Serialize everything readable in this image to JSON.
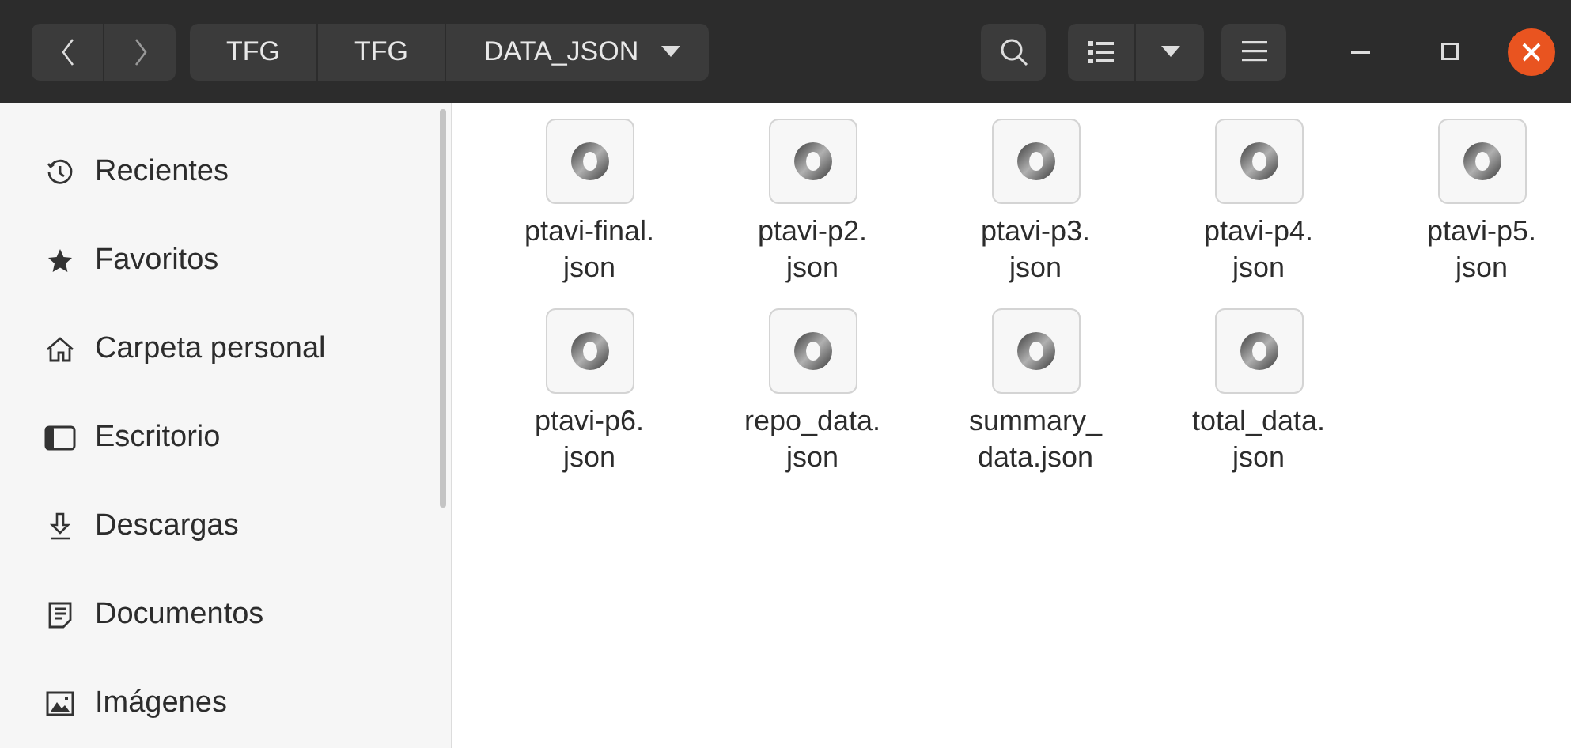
{
  "path_bar": {
    "segments": [
      {
        "label": "TFG"
      },
      {
        "label": "TFG"
      },
      {
        "label": "DATA_JSON"
      }
    ]
  },
  "sidebar": {
    "items": [
      {
        "label": "Recientes",
        "kind": "recent"
      },
      {
        "label": "Favoritos",
        "kind": "starred"
      },
      {
        "label": "Carpeta personal",
        "kind": "home"
      },
      {
        "label": "Escritorio",
        "kind": "desktop"
      },
      {
        "label": "Descargas",
        "kind": "downloads"
      },
      {
        "label": "Documentos",
        "kind": "documents"
      },
      {
        "label": "Imágenes",
        "kind": "pictures"
      }
    ]
  },
  "files": [
    {
      "name_lines": [
        "ptavi-final.",
        "json"
      ]
    },
    {
      "name_lines": [
        "ptavi-p2.",
        "json"
      ]
    },
    {
      "name_lines": [
        "ptavi-p3.",
        "json"
      ]
    },
    {
      "name_lines": [
        "ptavi-p4.",
        "json"
      ]
    },
    {
      "name_lines": [
        "ptavi-p5.",
        "json"
      ]
    },
    {
      "name_lines": [
        "ptavi-p6.",
        "json"
      ]
    },
    {
      "name_lines": [
        "repo_data.",
        "json"
      ]
    },
    {
      "name_lines": [
        "summary_",
        "data.json"
      ]
    },
    {
      "name_lines": [
        "total_data.",
        "json"
      ]
    }
  ]
}
